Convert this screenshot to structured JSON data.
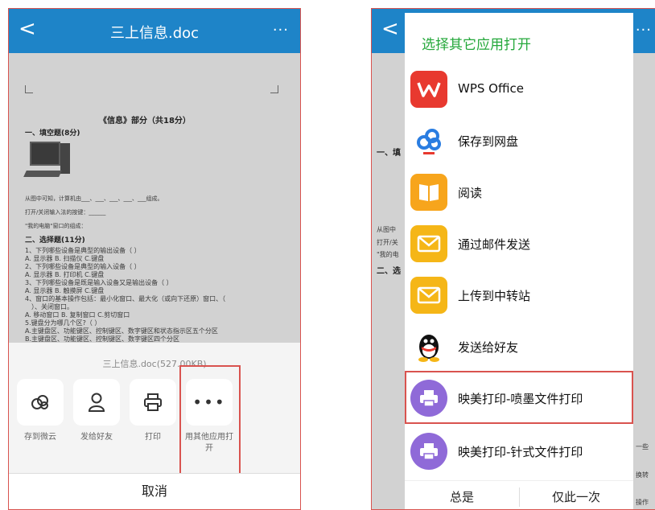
{
  "left": {
    "topbar": {
      "back": "<",
      "title": "三上信息.doc",
      "more": "···"
    },
    "document": {
      "heading": "《信息》部分（共18分）",
      "section1": "一、填空题(8分)",
      "fill1": "从图中可知，计算机由___、___、___、___、___组成。",
      "fill2": "打开/关闭输入法的按键：______",
      "fill3": "\"我的电脑\"窗口的组成：",
      "section2": "二、选择题(11分)",
      "q1": "1、下列哪些设备是典型的输出设备（    ）",
      "q1o": "A. 显示器    B. 扫描仪    C.键盘",
      "q2": "2、下列哪些设备是典型的输入设备（    ）",
      "q2o": "A. 显示器    B. 打印机    C.键盘",
      "q3": "3、下列哪些设备是既是输入设备又是输出设备（    ）",
      "q3o": "A. 显示器    B. 触摸屏    C.键盘",
      "q4": "4、窗口的基本操作包括：最小化窗口、最大化（或向下还原）窗口、（",
      "q4b": "）、关闭窗口。",
      "q4o": "A. 移动窗口    B. 复制窗口    C.剪切窗口",
      "q5": "5.键盘分为哪几个区?（    ）",
      "q5a": "A.主键盘区、功能键区、控制键区、数字键区和状态指示区五个分区",
      "q5b": "B.主键盘区、功能键区、控制键区、数字键区四个分区"
    },
    "sheet": {
      "filename": "三上信息.doc(527.00KB)",
      "options": [
        {
          "icon": "cloud-icon",
          "label": "存到微云"
        },
        {
          "icon": "person-icon",
          "label": "发给好友"
        },
        {
          "icon": "printer-icon",
          "label": "打印"
        },
        {
          "icon": "more-icon",
          "label": "用其他应用打开"
        }
      ],
      "cancel": "取消"
    }
  },
  "right": {
    "dialog": {
      "title": "选择其它应用打开",
      "apps": [
        {
          "icon": "wps-icon",
          "label": "WPS Office"
        },
        {
          "icon": "baidu-netdisk-icon",
          "label": "保存到网盘"
        },
        {
          "icon": "book-icon",
          "label": "阅读"
        },
        {
          "icon": "mail-icon",
          "label": "通过邮件发送"
        },
        {
          "icon": "mail-icon",
          "label": "上传到中转站"
        },
        {
          "icon": "qq-icon",
          "label": "发送给好友"
        },
        {
          "icon": "printer-icon",
          "label": "映美打印-喷墨文件打印"
        },
        {
          "icon": "printer-icon",
          "label": "映美打印-针式文件打印"
        }
      ],
      "always": "总是",
      "once": "仅此一次"
    }
  },
  "colors": {
    "topbar": "#1e84c8",
    "dialog_title": "#25a83b",
    "highlight": "#d9534f"
  }
}
